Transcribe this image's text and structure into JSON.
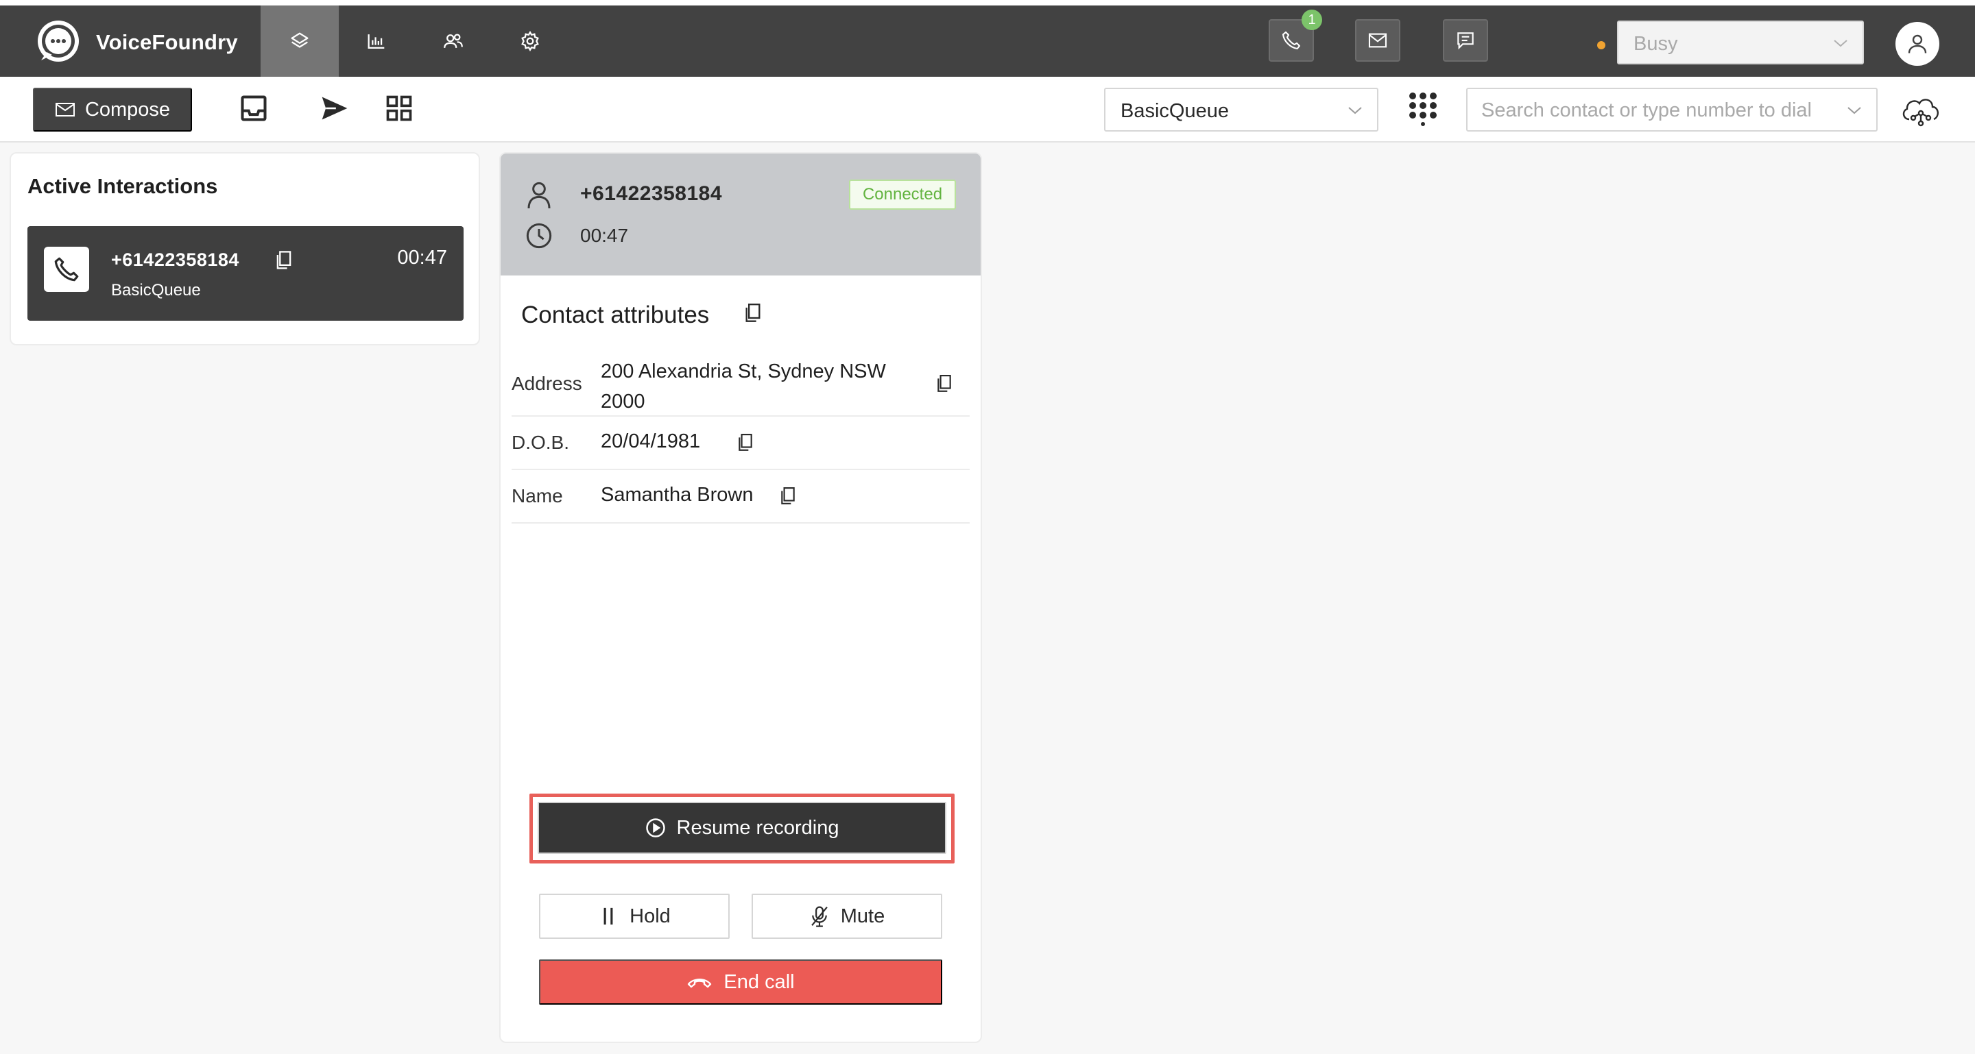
{
  "app": {
    "brand": "VoiceFoundry"
  },
  "topbar": {
    "nav": [
      "layers-icon",
      "chart-icon",
      "people-icon",
      "gear-icon"
    ],
    "phone_notification_count": "1",
    "status": {
      "value": "Busy",
      "dot_color": "#f0a331"
    }
  },
  "toolbar": {
    "compose_label": "Compose",
    "queue": {
      "value": "BasicQueue"
    },
    "search": {
      "placeholder": "Search contact or type number to dial"
    }
  },
  "active_interactions": {
    "title": "Active Interactions",
    "items": [
      {
        "number": "+61422358184",
        "queue": "BasicQueue",
        "timer": "00:47"
      }
    ]
  },
  "contact": {
    "number": "+61422358184",
    "duration": "00:47",
    "status": "Connected",
    "attributes_title": "Contact attributes",
    "attributes": [
      {
        "label": "Address",
        "value": "200 Alexandria St, Sydney NSW 2000"
      },
      {
        "label": "D.O.B.",
        "value": "20/04/1981"
      },
      {
        "label": "Name",
        "value": "Samantha Brown"
      }
    ]
  },
  "controls": {
    "resume_label": "Resume recording",
    "hold_label": "Hold",
    "mute_label": "Mute",
    "end_label": "End call"
  },
  "colors": {
    "topbar": "#424242",
    "accent_red": "#ec5b55",
    "connected_green": "#62b33f",
    "highlight_outline": "#e8605a"
  }
}
